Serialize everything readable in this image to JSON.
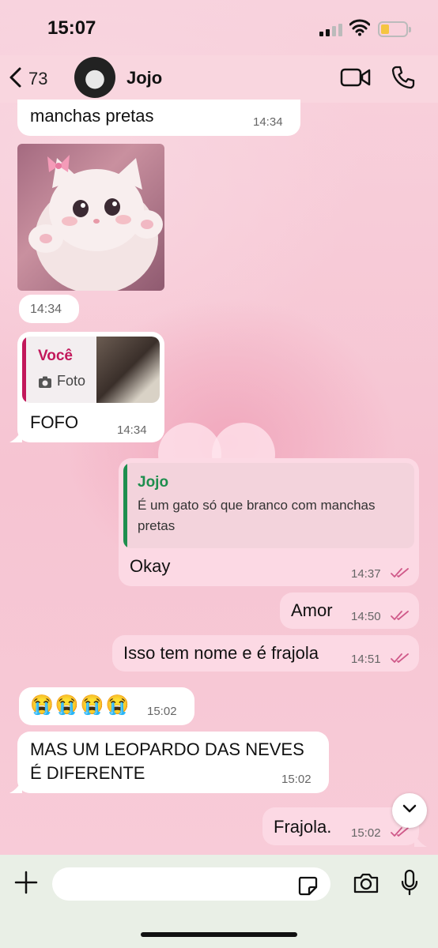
{
  "status_bar": {
    "time": "15:07"
  },
  "header": {
    "back_count": "73",
    "contact_name": "Jojo"
  },
  "messages": [
    {
      "id": 1,
      "direction": "in",
      "text": "manchas pretas",
      "time": "14:34"
    },
    {
      "id": 2,
      "direction": "in",
      "type": "image",
      "image": "white-kitten-with-pink-bow",
      "time": "14:34"
    },
    {
      "id": 3,
      "direction": "in",
      "reply_to": {
        "author": "Você",
        "media_label": "Foto",
        "thumb": "dark-kitten-photo"
      },
      "text": "FOFO",
      "time": "14:34"
    },
    {
      "id": 4,
      "direction": "out",
      "reply_to": {
        "author": "Jojo",
        "text_line1": "É um gato só que branco com manchas",
        "text_line2": "pretas"
      },
      "text": "Okay",
      "time": "14:37",
      "status": "read"
    },
    {
      "id": 5,
      "direction": "out",
      "text": "Amor",
      "time": "14:50",
      "status": "read"
    },
    {
      "id": 6,
      "direction": "out",
      "text": "Isso tem nome e é frajola",
      "time": "14:51",
      "status": "read"
    },
    {
      "id": 7,
      "direction": "in",
      "text": "😭😭😭😭",
      "time": "15:02"
    },
    {
      "id": 8,
      "direction": "in",
      "text_line1": "MAS UM LEOPARDO DAS NEVES",
      "text_line2": "É DIFERENTE",
      "time": "15:02"
    },
    {
      "id": 9,
      "direction": "out",
      "text": "Frajola.",
      "time": "15:02",
      "status": "read"
    }
  ],
  "input": {
    "value": "",
    "placeholder": ""
  },
  "colors": {
    "accent_in_reply": "#c2185b",
    "accent_out_reply": "#1e8e4e",
    "read_ticks": "#d05a8a"
  }
}
